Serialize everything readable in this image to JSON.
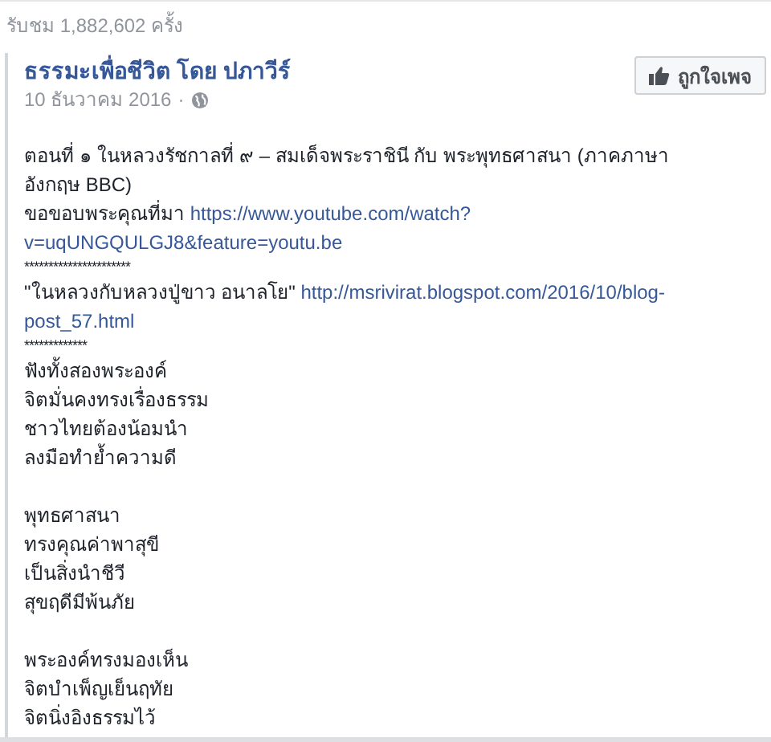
{
  "views": "รับชม 1,882,602 ครั้ง",
  "post": {
    "page_name": "ธรรมะเพื่อชีวิต โดย ปภาวีร์",
    "date": "10 ธันวาคม 2016",
    "separator": "·",
    "like_button": "ถูกใจเพจ",
    "lines": [
      {
        "kind": "text",
        "segments": [
          {
            "kind": "text",
            "text": "ตอนที่ ๑ ในหลวงรัชกาลที่ ๙ – สมเด็จพระราชินี กับ พระพุทธศาสนา (ภาคภาษา"
          }
        ]
      },
      {
        "kind": "text",
        "segments": [
          {
            "kind": "text",
            "text": "อังกฤษ BBC)"
          }
        ]
      },
      {
        "kind": "text",
        "segments": [
          {
            "kind": "text",
            "text": "ขอขอบพระคุณที่มา "
          },
          {
            "kind": "link",
            "text": "https://www.youtube.com/watch?"
          }
        ]
      },
      {
        "kind": "text",
        "segments": [
          {
            "kind": "link",
            "text": "v=uqUNGQULGJ8&feature=youtu.be"
          }
        ]
      },
      {
        "kind": "stars",
        "text": "**********************"
      },
      {
        "kind": "text",
        "segments": [
          {
            "kind": "text",
            "text": "\"ในหลวงกับหลวงปู่ขาว อนาลโย\" "
          },
          {
            "kind": "link",
            "text": "http://msrivirat.blogspot.com/2016/10/blog-"
          }
        ]
      },
      {
        "kind": "text",
        "segments": [
          {
            "kind": "link",
            "text": "post_57.html"
          }
        ]
      },
      {
        "kind": "stars",
        "text": "*************"
      },
      {
        "kind": "text",
        "segments": [
          {
            "kind": "text",
            "text": "ฟังทั้งสองพระองค์"
          }
        ]
      },
      {
        "kind": "text",
        "segments": [
          {
            "kind": "text",
            "text": "จิตมั่นคงทรงเรื่องธรรม"
          }
        ]
      },
      {
        "kind": "text",
        "segments": [
          {
            "kind": "text",
            "text": "ชาวไทยต้องน้อมนำ"
          }
        ]
      },
      {
        "kind": "text",
        "segments": [
          {
            "kind": "text",
            "text": "ลงมือทำย้ำความดี"
          }
        ]
      },
      {
        "kind": "blank"
      },
      {
        "kind": "text",
        "segments": [
          {
            "kind": "text",
            "text": "พุทธศาสนา"
          }
        ]
      },
      {
        "kind": "text",
        "segments": [
          {
            "kind": "text",
            "text": "ทรงคุณค่าพาสุขี"
          }
        ]
      },
      {
        "kind": "text",
        "segments": [
          {
            "kind": "text",
            "text": "เป็นสิ่งนำชีวี"
          }
        ]
      },
      {
        "kind": "text",
        "segments": [
          {
            "kind": "text",
            "text": "สุขฤดีมีพ้นภัย"
          }
        ]
      },
      {
        "kind": "blank"
      },
      {
        "kind": "text",
        "segments": [
          {
            "kind": "text",
            "text": "พระองค์ทรงมองเห็น"
          }
        ]
      },
      {
        "kind": "text",
        "segments": [
          {
            "kind": "text",
            "text": "จิตบำเพ็ญเย็นฤทัย"
          }
        ]
      },
      {
        "kind": "text",
        "segments": [
          {
            "kind": "text",
            "text": "จิตนิ่งอิงธรรมไว้"
          }
        ]
      }
    ]
  }
}
